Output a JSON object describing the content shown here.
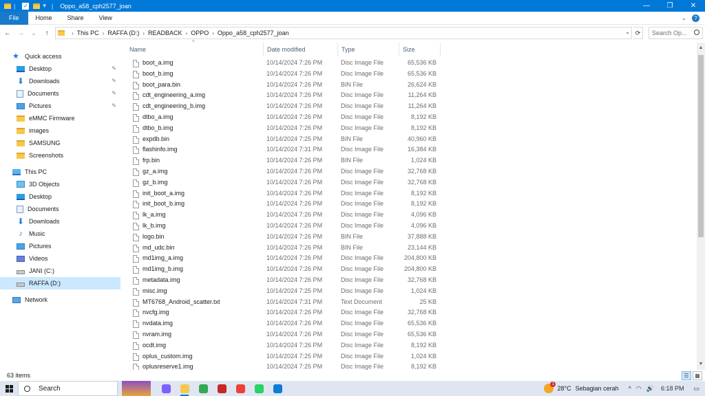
{
  "window": {
    "title": "Oppo_a58_cph2577_joan",
    "quick_access_sep": "|",
    "minimize": "—",
    "maximize": "❐",
    "close": "✕"
  },
  "ribbon": {
    "tabs": [
      "File",
      "Home",
      "Share",
      "View"
    ],
    "expand": "⌄",
    "help": "?"
  },
  "address": {
    "back": "←",
    "forward": "→",
    "recent": "⌄",
    "up": "↑",
    "crumbs": [
      "This PC",
      "RAFFA (D:)",
      "READBACK",
      "OPPO",
      "Oppo_a58_cph2577_joan"
    ],
    "dropdown": "⌄",
    "refresh": "⟳",
    "search_placeholder": "Search Op..."
  },
  "nav": {
    "quick_access": "Quick access",
    "quick_items": [
      {
        "label": "Desktop",
        "icon": "desktop-icon",
        "pinned": true
      },
      {
        "label": "Downloads",
        "icon": "download-icon",
        "pinned": true
      },
      {
        "label": "Documents",
        "icon": "documents-icon",
        "pinned": true
      },
      {
        "label": "Pictures",
        "icon": "pictures-icon",
        "pinned": true
      },
      {
        "label": "eMMC Firmware",
        "icon": "folder-icon",
        "pinned": false
      },
      {
        "label": "images",
        "icon": "folder-icon",
        "pinned": false
      },
      {
        "label": "SAMSUNG",
        "icon": "folder-icon",
        "pinned": false
      },
      {
        "label": "Screenshots",
        "icon": "folder-icon",
        "pinned": false
      }
    ],
    "this_pc": "This PC",
    "pc_items": [
      {
        "label": "3D Objects",
        "icon": "3d-objects-icon"
      },
      {
        "label": "Desktop",
        "icon": "desktop-icon"
      },
      {
        "label": "Documents",
        "icon": "documents-icon"
      },
      {
        "label": "Downloads",
        "icon": "download-icon"
      },
      {
        "label": "Music",
        "icon": "music-icon"
      },
      {
        "label": "Pictures",
        "icon": "pictures-icon"
      },
      {
        "label": "Videos",
        "icon": "videos-icon"
      },
      {
        "label": "JANI (C:)",
        "icon": "drive-icon"
      },
      {
        "label": "RAFFA (D:)",
        "icon": "drive-icon"
      }
    ],
    "network": "Network",
    "pin_glyph": "📌"
  },
  "columns": {
    "name": "Name",
    "date": "Date modified",
    "type": "Type",
    "size": "Size",
    "sort_indicator": "^"
  },
  "files": [
    {
      "name": "boot_a.img",
      "date": "10/14/2024 7:26 PM",
      "type": "Disc Image File",
      "size": "65,536 KB"
    },
    {
      "name": "boot_b.img",
      "date": "10/14/2024 7:26 PM",
      "type": "Disc Image File",
      "size": "65,536 KB"
    },
    {
      "name": "boot_para.bin",
      "date": "10/14/2024 7:26 PM",
      "type": "BIN File",
      "size": "26,624 KB"
    },
    {
      "name": "cdt_engineering_a.img",
      "date": "10/14/2024 7:26 PM",
      "type": "Disc Image File",
      "size": "11,264 KB"
    },
    {
      "name": "cdt_engineering_b.img",
      "date": "10/14/2024 7:26 PM",
      "type": "Disc Image File",
      "size": "11,264 KB"
    },
    {
      "name": "dtbo_a.img",
      "date": "10/14/2024 7:26 PM",
      "type": "Disc Image File",
      "size": "8,192 KB"
    },
    {
      "name": "dtbo_b.img",
      "date": "10/14/2024 7:26 PM",
      "type": "Disc Image File",
      "size": "8,192 KB"
    },
    {
      "name": "expdb.bin",
      "date": "10/14/2024 7:25 PM",
      "type": "BIN File",
      "size": "40,960 KB"
    },
    {
      "name": "flashinfo.img",
      "date": "10/14/2024 7:31 PM",
      "type": "Disc Image File",
      "size": "16,384 KB"
    },
    {
      "name": "frp.bin",
      "date": "10/14/2024 7:26 PM",
      "type": "BIN File",
      "size": "1,024 KB"
    },
    {
      "name": "gz_a.img",
      "date": "10/14/2024 7:26 PM",
      "type": "Disc Image File",
      "size": "32,768 KB"
    },
    {
      "name": "gz_b.img",
      "date": "10/14/2024 7:26 PM",
      "type": "Disc Image File",
      "size": "32,768 KB"
    },
    {
      "name": "init_boot_a.img",
      "date": "10/14/2024 7:26 PM",
      "type": "Disc Image File",
      "size": "8,192 KB"
    },
    {
      "name": "init_boot_b.img",
      "date": "10/14/2024 7:26 PM",
      "type": "Disc Image File",
      "size": "8,192 KB"
    },
    {
      "name": "lk_a.img",
      "date": "10/14/2024 7:26 PM",
      "type": "Disc Image File",
      "size": "4,096 KB"
    },
    {
      "name": "lk_b.img",
      "date": "10/14/2024 7:26 PM",
      "type": "Disc Image File",
      "size": "4,096 KB"
    },
    {
      "name": "logo.bin",
      "date": "10/14/2024 7:26 PM",
      "type": "BIN File",
      "size": "37,888 KB"
    },
    {
      "name": "md_udc.bin",
      "date": "10/14/2024 7:26 PM",
      "type": "BIN File",
      "size": "23,144 KB"
    },
    {
      "name": "md1img_a.img",
      "date": "10/14/2024 7:26 PM",
      "type": "Disc Image File",
      "size": "204,800 KB"
    },
    {
      "name": "md1img_b.img",
      "date": "10/14/2024 7:26 PM",
      "type": "Disc Image File",
      "size": "204,800 KB"
    },
    {
      "name": "metadata.img",
      "date": "10/14/2024 7:26 PM",
      "type": "Disc Image File",
      "size": "32,768 KB"
    },
    {
      "name": "misc.img",
      "date": "10/14/2024 7:25 PM",
      "type": "Disc Image File",
      "size": "1,024 KB"
    },
    {
      "name": "MT6768_Android_scatter.txt",
      "date": "10/14/2024 7:31 PM",
      "type": "Text Document",
      "size": "25 KB"
    },
    {
      "name": "nvcfg.img",
      "date": "10/14/2024 7:26 PM",
      "type": "Disc Image File",
      "size": "32,768 KB"
    },
    {
      "name": "nvdata.img",
      "date": "10/14/2024 7:26 PM",
      "type": "Disc Image File",
      "size": "65,536 KB"
    },
    {
      "name": "nvram.img",
      "date": "10/14/2024 7:26 PM",
      "type": "Disc Image File",
      "size": "65,536 KB"
    },
    {
      "name": "ocdt.img",
      "date": "10/14/2024 7:26 PM",
      "type": "Disc Image File",
      "size": "8,192 KB"
    },
    {
      "name": "oplus_custom.img",
      "date": "10/14/2024 7:25 PM",
      "type": "Disc Image File",
      "size": "1,024 KB"
    },
    {
      "name": "oplusreserve1.img",
      "date": "10/14/2024 7:25 PM",
      "type": "Disc Image File",
      "size": "8,192 KB"
    }
  ],
  "status": {
    "item_count": "63 items"
  },
  "taskbar": {
    "search_label": "Search",
    "weather_temp": "28°C",
    "weather_desc": "Sebagian cerah",
    "weather_badge": "1",
    "time": "6:18 PM",
    "tray_chevron": "^",
    "apps": [
      {
        "name": "chrome-ai-icon",
        "color": "#7b61ff"
      },
      {
        "name": "file-explorer-icon",
        "color": "#f7c84a"
      },
      {
        "name": "chrome-icon",
        "color": "#34a853"
      },
      {
        "name": "red-app-icon",
        "color": "#c62828"
      },
      {
        "name": "chrome-profile-icon",
        "color": "#ea4335"
      },
      {
        "name": "whatsapp-icon",
        "color": "#25d366"
      },
      {
        "name": "edge-icon",
        "color": "#0c7cd5"
      }
    ]
  },
  "colors": {
    "titlebar": "#0078d7",
    "selection": "#cce8ff",
    "file_tab": "#1979ca"
  }
}
